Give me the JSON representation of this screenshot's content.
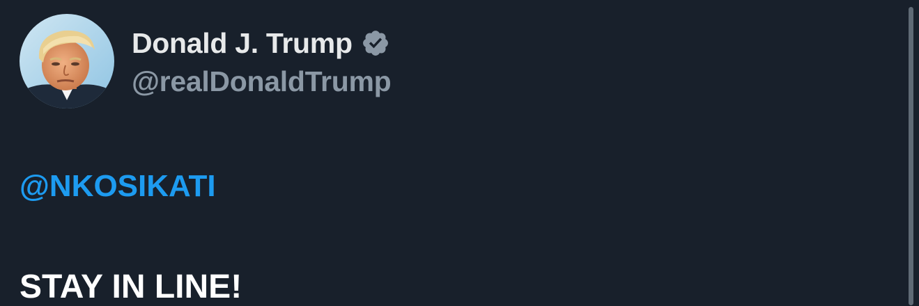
{
  "tweet": {
    "author": {
      "display_name": "Donald J. Trump",
      "handle": "@realDonaldTrump",
      "verified": true,
      "avatar_icon": "profile-photo"
    },
    "mention": "@NKOSIKATI",
    "text": "STAY IN LINE!"
  },
  "colors": {
    "background": "#18202b",
    "name": "#e7e9ea",
    "handle": "#8b98a5",
    "mention": "#1d9bf0",
    "verified_badge": "#8b98a5"
  }
}
